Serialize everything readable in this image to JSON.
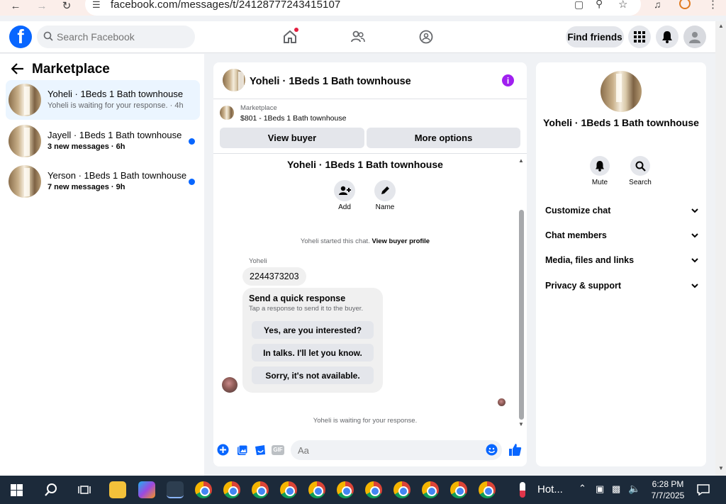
{
  "browser": {
    "url": "facebook.com/messages/t/24128777243415107"
  },
  "topnav": {
    "search_placeholder": "Search Facebook",
    "find_friends": "Find friends"
  },
  "left": {
    "title": "Marketplace",
    "conversations": [
      {
        "name": "Yoheli · 1Beds 1 Bath townhouse",
        "sub": "Yoheli is waiting for your response. · 4h",
        "unread": false
      },
      {
        "name": "Jayell · 1Beds 1 Bath townhouse",
        "sub": "3 new messages · 6h",
        "unread": true
      },
      {
        "name": "Yerson · 1Beds 1 Bath townhouse",
        "sub": "7 new messages · 9h",
        "unread": true
      }
    ]
  },
  "chat": {
    "title": "Yoheli · 1Beds 1 Bath townhouse",
    "marketplace_label": "Marketplace",
    "listing": "$801 - 1Beds 1 Bath townhouse",
    "view_buyer": "View buyer",
    "more_options": "More options",
    "intro_title": "Yoheli · 1Beds 1 Bath townhouse",
    "add_label": "Add",
    "name_label": "Name",
    "started_text": "Yoheli started this chat.",
    "view_profile": "View buyer profile",
    "sender": "Yoheli",
    "phone_message": "2244373203",
    "quick_title": "Send a quick response",
    "quick_sub": "Tap a response to send it to the buyer.",
    "quick_responses": [
      "Yes, are you interested?",
      "In talks. I'll let you know.",
      "Sorry, it's not available."
    ],
    "waiting_text": "Yoheli is waiting for your response.",
    "input_placeholder": "Aa"
  },
  "right": {
    "name": "Yoheli · 1Beds 1 Bath townhouse",
    "mute": "Mute",
    "search": "Search",
    "sections": [
      "Customize chat",
      "Chat members",
      "Media, files and links",
      "Privacy & support"
    ]
  },
  "taskbar": {
    "weather": "Hot...",
    "time": "6:28 PM",
    "date": "7/7/2025"
  },
  "colors": {
    "accent": "#0866ff",
    "info": "#a020f0"
  }
}
